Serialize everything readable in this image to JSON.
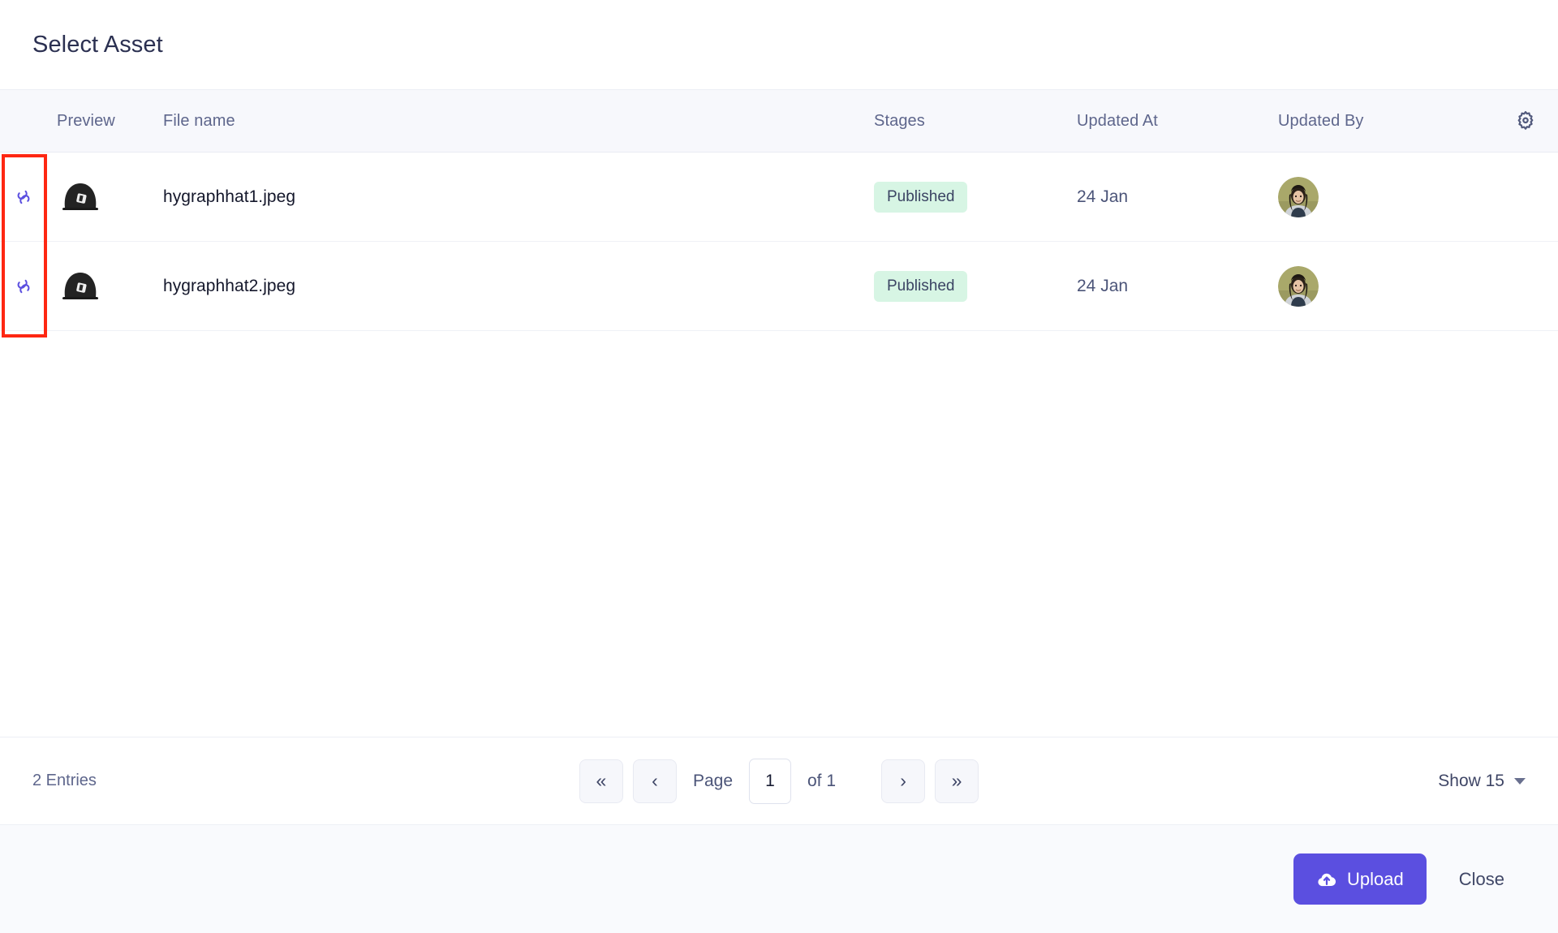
{
  "dialog": {
    "title": "Select Asset"
  },
  "table": {
    "columns": {
      "link": "",
      "preview": "Preview",
      "filename": "File name",
      "stages": "Stages",
      "updated_at": "Updated At",
      "updated_by": "Updated By",
      "settings_icon": "gear-icon"
    },
    "rows": [
      {
        "link_icon": "link-icon",
        "preview_alt": "black baseball cap thumbnail",
        "filename": "hygraphhat1.jpeg",
        "stage": "Published",
        "updated_at": "24 Jan",
        "updated_by_alt": "user avatar"
      },
      {
        "link_icon": "link-icon",
        "preview_alt": "black baseball cap thumbnail",
        "filename": "hygraphhat2.jpeg",
        "stage": "Published",
        "updated_at": "24 Jan",
        "updated_by_alt": "user avatar"
      }
    ]
  },
  "pagination": {
    "entries": "2 Entries",
    "first_label": "«",
    "prev_label": "‹",
    "page_label": "Page",
    "page_value": "1",
    "of_label": "of 1",
    "next_label": "›",
    "last_label": "»",
    "show_label": "Show 15"
  },
  "actions": {
    "upload_label": "Upload",
    "close_label": "Close"
  },
  "colors": {
    "accent": "#5b4fe0",
    "badge_bg": "#d7f5e4",
    "header_bg": "#f7f8fc",
    "annotation": "#fe2712"
  }
}
